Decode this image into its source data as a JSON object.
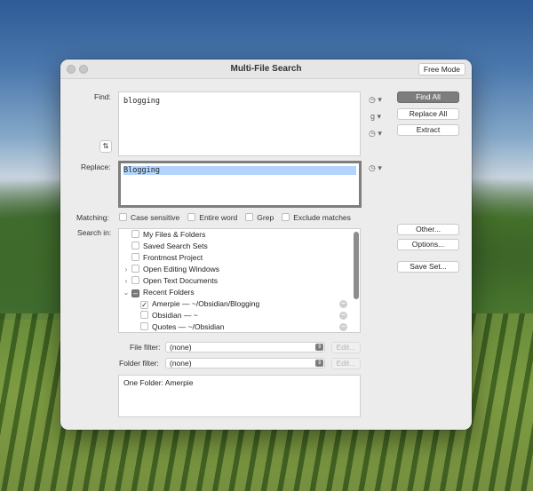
{
  "window": {
    "title": "Multi-File Search",
    "free_mode_label": "Free Mode"
  },
  "find": {
    "label": "Find:",
    "value": "blogging",
    "swap_glyph": "⇅"
  },
  "replace": {
    "label": "Replace:",
    "value": "Blogging"
  },
  "side_menus": {
    "history_glyph": "◷ ▾",
    "grep_glyph": "g ▾"
  },
  "buttons": {
    "find_all": "Find All",
    "replace_all": "Replace All",
    "extract": "Extract",
    "other": "Other...",
    "options": "Options...",
    "save_set": "Save Set...",
    "edit_file": "Edit...",
    "edit_folder": "Edit..."
  },
  "matching": {
    "label": "Matching:",
    "options": [
      "Case sensitive",
      "Entire word",
      "Grep",
      "Exclude matches"
    ]
  },
  "search_in": {
    "label": "Search in:",
    "items": [
      {
        "label": "My Files & Folders"
      },
      {
        "label": "Saved Search Sets"
      },
      {
        "label": "Frontmost Project"
      },
      {
        "label": "Open Editing Windows",
        "disclosure": "›"
      },
      {
        "label": "Open Text Documents",
        "disclosure": "›"
      },
      {
        "label": "Recent Folders",
        "disclosure": "⌄"
      },
      {
        "label": "Amerpie — ~/Obsidian/Blogging",
        "checked": "✓"
      },
      {
        "label": "Obsidian — ~"
      },
      {
        "label": "Quotes — ~/Obsidian"
      }
    ],
    "mixed_glyph": "–"
  },
  "filters": {
    "file_label": "File filter:",
    "file_value": "(none)",
    "folder_label": "Folder filter:",
    "folder_value": "(none)"
  },
  "results": {
    "summary": "One Folder: Amerpie"
  }
}
